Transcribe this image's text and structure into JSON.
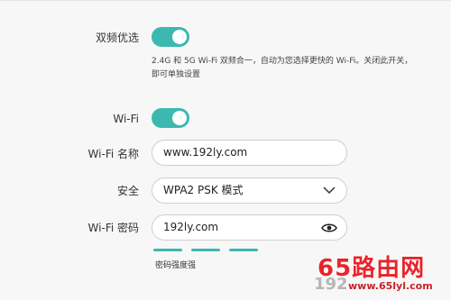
{
  "dual_band": {
    "label": "双频优选",
    "enabled": true,
    "description": "2.4G 和 5G Wi-Fi 双频合一，自动为您选择更快的 Wi-Fi。关闭此开关，即可单独设置"
  },
  "wifi": {
    "label": "Wi-Fi",
    "enabled": true
  },
  "wifi_name": {
    "label": "Wi-Fi 名称",
    "value": "www.192ly.com"
  },
  "security": {
    "label": "安全",
    "selected": "WPA2 PSK 模式"
  },
  "wifi_password": {
    "label": "Wi-Fi 密码",
    "value": "192ly.com"
  },
  "password_strength": {
    "text": "密码强度强",
    "level": 3,
    "max": 3
  },
  "watermark": {
    "main": "65路由网",
    "url": "www.65lyl.com"
  },
  "colors": {
    "accent": "#3bb9b0",
    "watermark": "#e9242a"
  }
}
